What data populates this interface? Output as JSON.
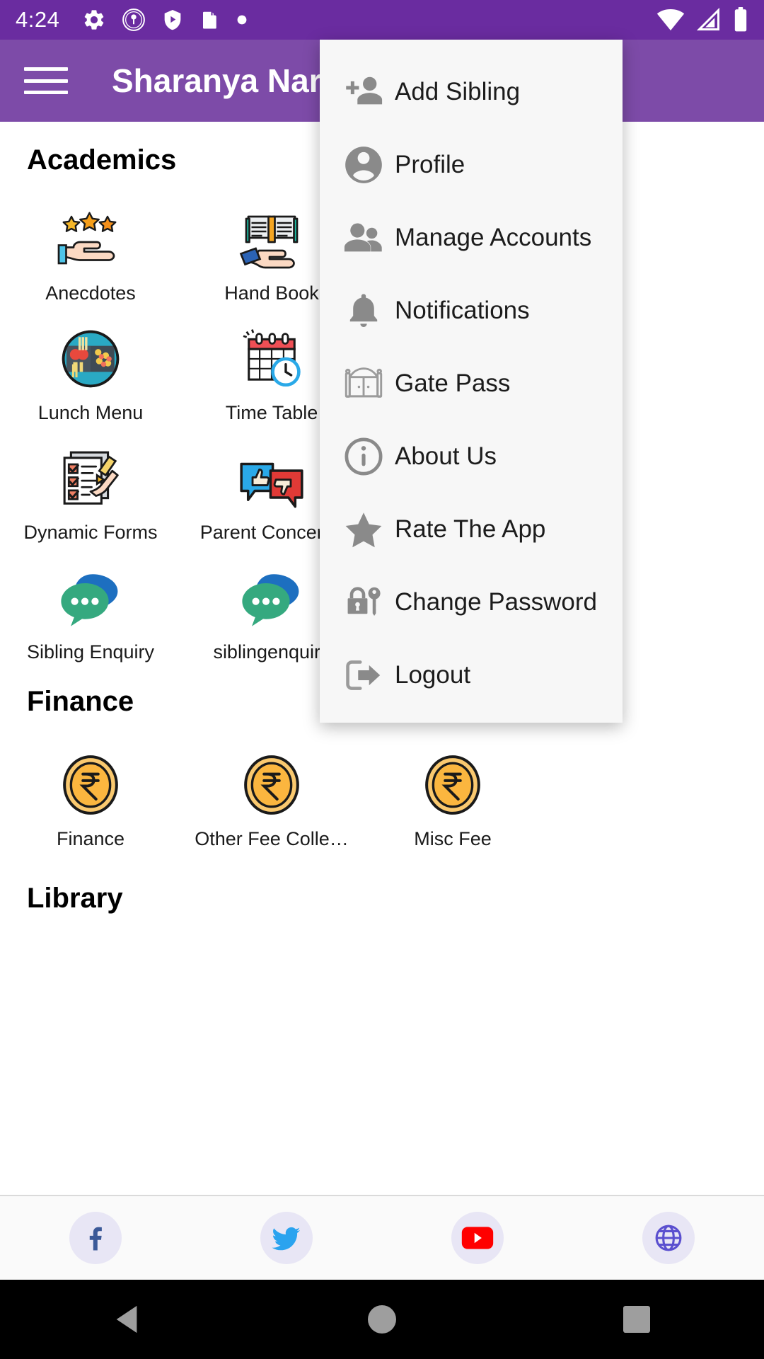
{
  "status_bar": {
    "time": "4:24",
    "left_icons": [
      "gear-icon",
      "school-logo-icon",
      "shield-play-icon",
      "sd-card-icon",
      "dot-icon"
    ],
    "right_icons": [
      "wifi-icon",
      "signal-icon",
      "battery-icon"
    ],
    "background_color": "#6a2ca0"
  },
  "app_bar": {
    "menu_icon": "hamburger-icon",
    "title": "Sharanya Naray",
    "background_color": "#7d4ba8"
  },
  "sections": [
    {
      "title": "Academics",
      "items": [
        {
          "label": "Anecdotes",
          "icon": "hand-stars-icon"
        },
        {
          "label": "Hand Book",
          "icon": "hand-book-icon"
        },
        {
          "label": "Lunch Menu",
          "icon": "lunch-tray-icon"
        },
        {
          "label": "Time Table",
          "icon": "calendar-clock-icon"
        },
        {
          "label": "Dynamic Forms",
          "icon": "form-pencil-icon"
        },
        {
          "label": "Parent Concerns",
          "icon": "feedback-bubbles-icon"
        },
        {
          "label": "Sibling Enquiry",
          "icon": "chat-bubbles-icon"
        },
        {
          "label": "siblingenquiry",
          "icon": "chat-bubbles-icon"
        }
      ]
    },
    {
      "title": "Finance",
      "items": [
        {
          "label": "Finance",
          "icon": "rupee-coin-icon"
        },
        {
          "label": "Other Fee Colle…",
          "icon": "rupee-coin-icon"
        },
        {
          "label": "Misc Fee",
          "icon": "rupee-coin-icon"
        }
      ]
    },
    {
      "title": "Library",
      "items": []
    }
  ],
  "overflow_menu": {
    "items": [
      {
        "label": "Add Sibling",
        "icon": "person-add-icon"
      },
      {
        "label": "Profile",
        "icon": "account-circle-icon"
      },
      {
        "label": "Manage Accounts",
        "icon": "people-icon"
      },
      {
        "label": "Notifications",
        "icon": "bell-icon"
      },
      {
        "label": "Gate Pass",
        "icon": "gate-icon"
      },
      {
        "label": "About Us",
        "icon": "info-circle-icon"
      },
      {
        "label": "Rate The App",
        "icon": "star-icon"
      },
      {
        "label": "Change Password",
        "icon": "lock-key-icon"
      },
      {
        "label": "Logout",
        "icon": "exit-icon"
      }
    ],
    "background_color": "#f7f7f7",
    "icon_color": "#8a8a8a"
  },
  "social_bar": {
    "items": [
      {
        "name": "facebook",
        "icon": "facebook-icon",
        "color": "#3b5998"
      },
      {
        "name": "twitter",
        "icon": "twitter-icon",
        "color": "#2aa3ef"
      },
      {
        "name": "youtube",
        "icon": "youtube-icon",
        "color": "#ff0000"
      },
      {
        "name": "website",
        "icon": "globe-icon",
        "color": "#5a4fcf"
      }
    ]
  },
  "nav_bar": {
    "buttons": [
      {
        "name": "back",
        "icon": "back-triangle-icon"
      },
      {
        "name": "home",
        "icon": "home-circle-icon"
      },
      {
        "name": "recents",
        "icon": "recents-square-icon"
      }
    ],
    "background_color": "#000000"
  }
}
